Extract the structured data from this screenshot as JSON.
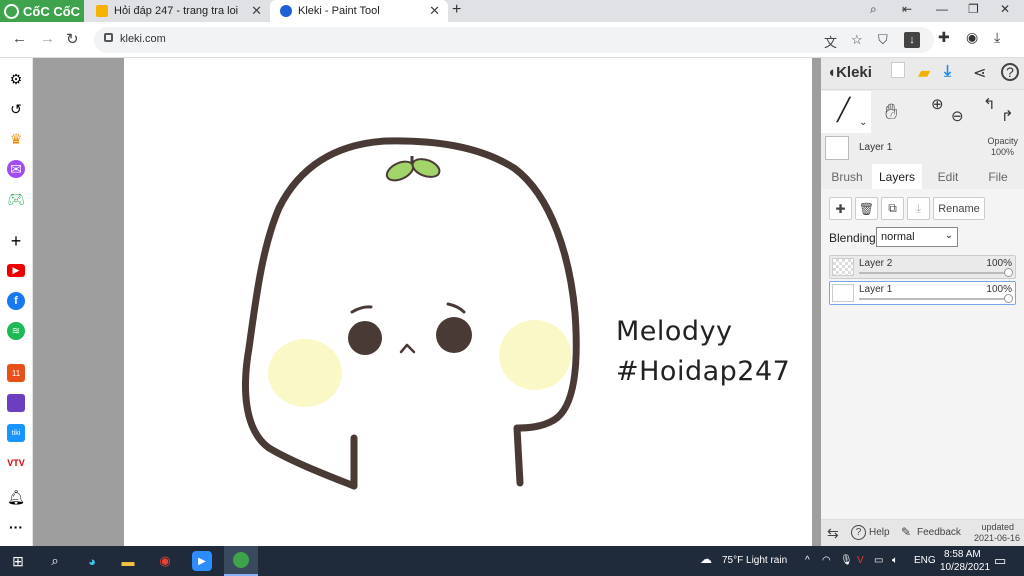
{
  "browser": {
    "name": "CốC CốC",
    "tabs": [
      {
        "title": "Hỏi đáp 247 - trang tra loi",
        "active": false
      },
      {
        "title": "Kleki - Paint Tool",
        "active": true
      }
    ],
    "url": "kleki.com"
  },
  "canvas": {
    "line1": "Melodyy",
    "line2": "#Hoidap247"
  },
  "kleki": {
    "logo": "Kleki",
    "current_layer": "Layer 1",
    "opacity_label": "Opacity",
    "opacity_value": "100%",
    "tabs": [
      "Brush",
      "Layers",
      "Edit",
      "File"
    ],
    "active_tab": "Layers",
    "rename_label": "Rename",
    "blending_label": "Blending",
    "blending_value": "normal",
    "layers": [
      {
        "name": "Layer 2",
        "opacity": "100%"
      },
      {
        "name": "Layer 1",
        "opacity": "100%",
        "selected": true
      }
    ],
    "footer": {
      "help": "Help",
      "feedback": "Feedback",
      "updated_label": "updated",
      "updated_date": "2021-06-16"
    }
  },
  "taskbar": {
    "weather": "75°F  Light rain",
    "lang": "ENG",
    "time": "8:58 AM",
    "date": "10/28/2021"
  },
  "colors": {
    "browser_green": "#3fa34d",
    "taskbar": "#1f2a3a",
    "kleki_blue": "#1e88e5",
    "drawing_stroke": "#4a3a36",
    "cheek": "#fbf8c8",
    "sprout": "#a3d46a"
  }
}
